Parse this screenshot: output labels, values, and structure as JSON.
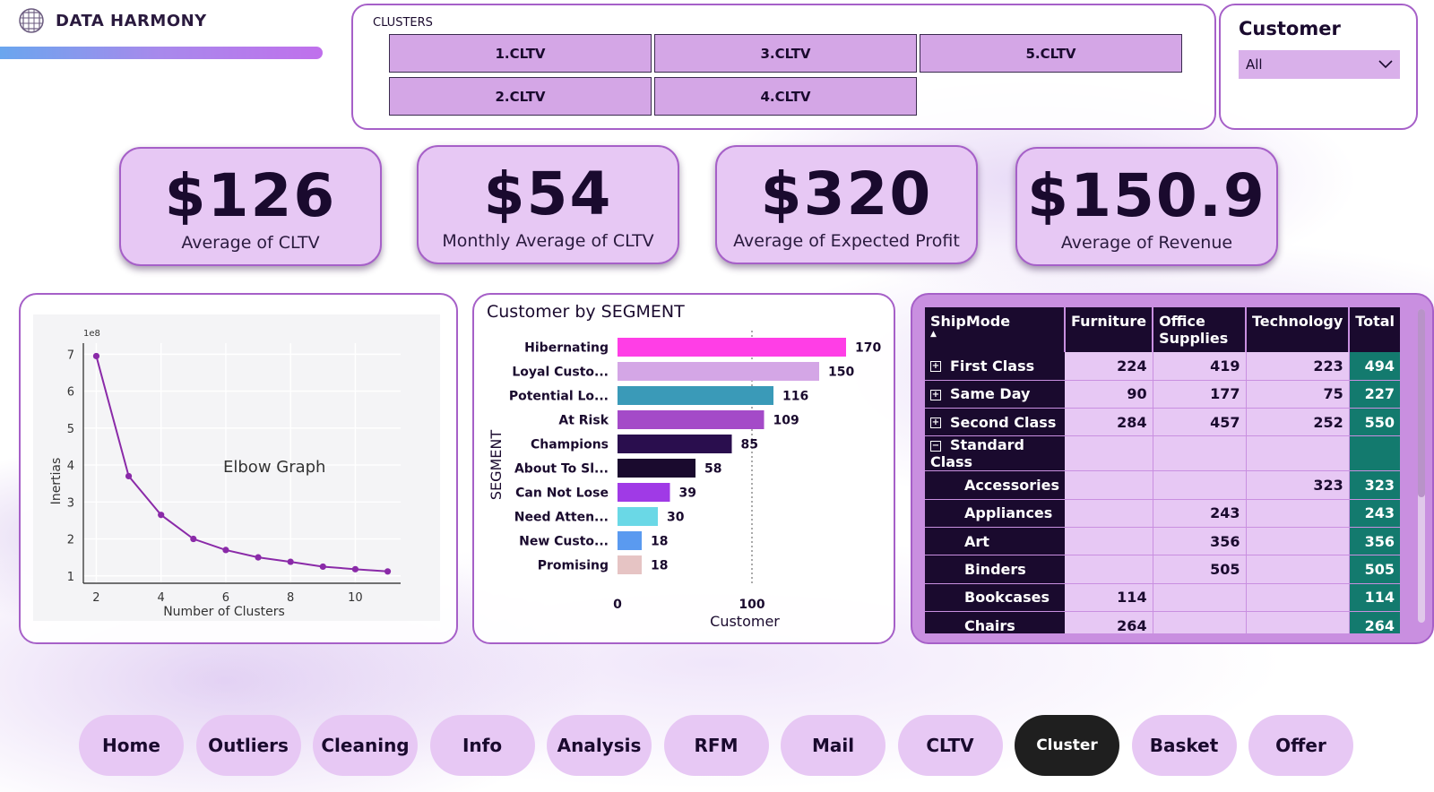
{
  "brand": {
    "name": "DATA HARMONY",
    "logo_icon": "grid-globe-icon"
  },
  "clusters": {
    "title": "CLUSTERS",
    "buttons": [
      "1.CLTV",
      "3.CLTV",
      "5.CLTV",
      "2.CLTV",
      "4.CLTV"
    ]
  },
  "customer_slicer": {
    "title": "Customer",
    "value": "All",
    "icon": "chevron-down-icon"
  },
  "kpis": [
    {
      "value": "$126",
      "label": "Average of CLTV"
    },
    {
      "value": "$54",
      "label": "Monthly Average of CLTV"
    },
    {
      "value": "$320",
      "label": "Average of Expected Profit"
    },
    {
      "value": "$150.9",
      "label": "Average of Revenue"
    }
  ],
  "chart_data": [
    {
      "type": "line",
      "annotation": "Elbow Graph",
      "xlabel": "Number of Clusters",
      "ylabel": "Inertias",
      "y_multiplier": "1e8",
      "x": [
        2,
        3,
        4,
        5,
        6,
        7,
        8,
        9,
        10,
        11
      ],
      "y": [
        6.95,
        3.7,
        2.65,
        2.0,
        1.7,
        1.5,
        1.38,
        1.25,
        1.18,
        1.12
      ],
      "xticks": [
        2,
        4,
        6,
        8,
        10
      ],
      "yticks": [
        1,
        2,
        3,
        4,
        5,
        6,
        7
      ],
      "xlim": [
        1.6,
        11.4
      ],
      "ylim": [
        0.8,
        7.3
      ],
      "grid": true,
      "colors": {
        "line": "#8a2aa8",
        "plot_bg": "#f4f4f6"
      }
    },
    {
      "type": "bar",
      "orientation": "horizontal",
      "title": "Customer by SEGMENT",
      "xlabel": "Customer",
      "ylabel": "SEGMENT",
      "categories": [
        "Hibernating",
        "Loyal Custo...",
        "Potential Lo...",
        "At Risk",
        "Champions",
        "About To Sl...",
        "Can Not Lose",
        "Need Atten...",
        "New Custo...",
        "Promising"
      ],
      "values": [
        170,
        150,
        116,
        109,
        85,
        58,
        39,
        30,
        18,
        18
      ],
      "colors": [
        "#ff3ee6",
        "#d4a6e6",
        "#3a9ab8",
        "#a44ac8",
        "#2a0e4e",
        "#1a0a2e",
        "#a03ae6",
        "#6ad8e6",
        "#5a9af0",
        "#e6c4c4"
      ],
      "xticks": [
        0,
        100
      ],
      "xlim": [
        0,
        190
      ],
      "reference_line_at": 100
    }
  ],
  "matrix": {
    "columns": [
      "ShipMode",
      "Furniture",
      "Office Supplies",
      "Technology",
      "Total"
    ],
    "rows": [
      {
        "label": "First Class",
        "expander": "+",
        "furniture": "224",
        "office": "419",
        "technology": "223",
        "total": "494",
        "sub": false
      },
      {
        "label": "Same Day",
        "expander": "+",
        "furniture": "90",
        "office": "177",
        "technology": "75",
        "total": "227",
        "sub": false
      },
      {
        "label": "Second Class",
        "expander": "+",
        "furniture": "284",
        "office": "457",
        "technology": "252",
        "total": "550",
        "sub": false
      },
      {
        "label": "Standard Class",
        "expander": "−",
        "furniture": "",
        "office": "",
        "technology": "",
        "total": "",
        "sub": false
      },
      {
        "label": "Accessories",
        "expander": "",
        "furniture": "",
        "office": "",
        "technology": "323",
        "total": "323",
        "sub": true
      },
      {
        "label": "Appliances",
        "expander": "",
        "furniture": "",
        "office": "243",
        "technology": "",
        "total": "243",
        "sub": true
      },
      {
        "label": "Art",
        "expander": "",
        "furniture": "",
        "office": "356",
        "technology": "",
        "total": "356",
        "sub": true
      },
      {
        "label": "Binders",
        "expander": "",
        "furniture": "",
        "office": "505",
        "technology": "",
        "total": "505",
        "sub": true
      },
      {
        "label": "Bookcases",
        "expander": "",
        "furniture": "114",
        "office": "",
        "technology": "",
        "total": "114",
        "sub": true
      },
      {
        "label": "Chairs",
        "expander": "",
        "furniture": "264",
        "office": "",
        "technology": "",
        "total": "264",
        "sub": true
      }
    ]
  },
  "nav": {
    "items": [
      "Home",
      "Outliers",
      "Cleaning",
      "Info",
      "Analysis",
      "RFM",
      "Mail",
      "CLTV",
      "Cluster",
      "Basket",
      "Offer"
    ],
    "active": "Cluster"
  }
}
